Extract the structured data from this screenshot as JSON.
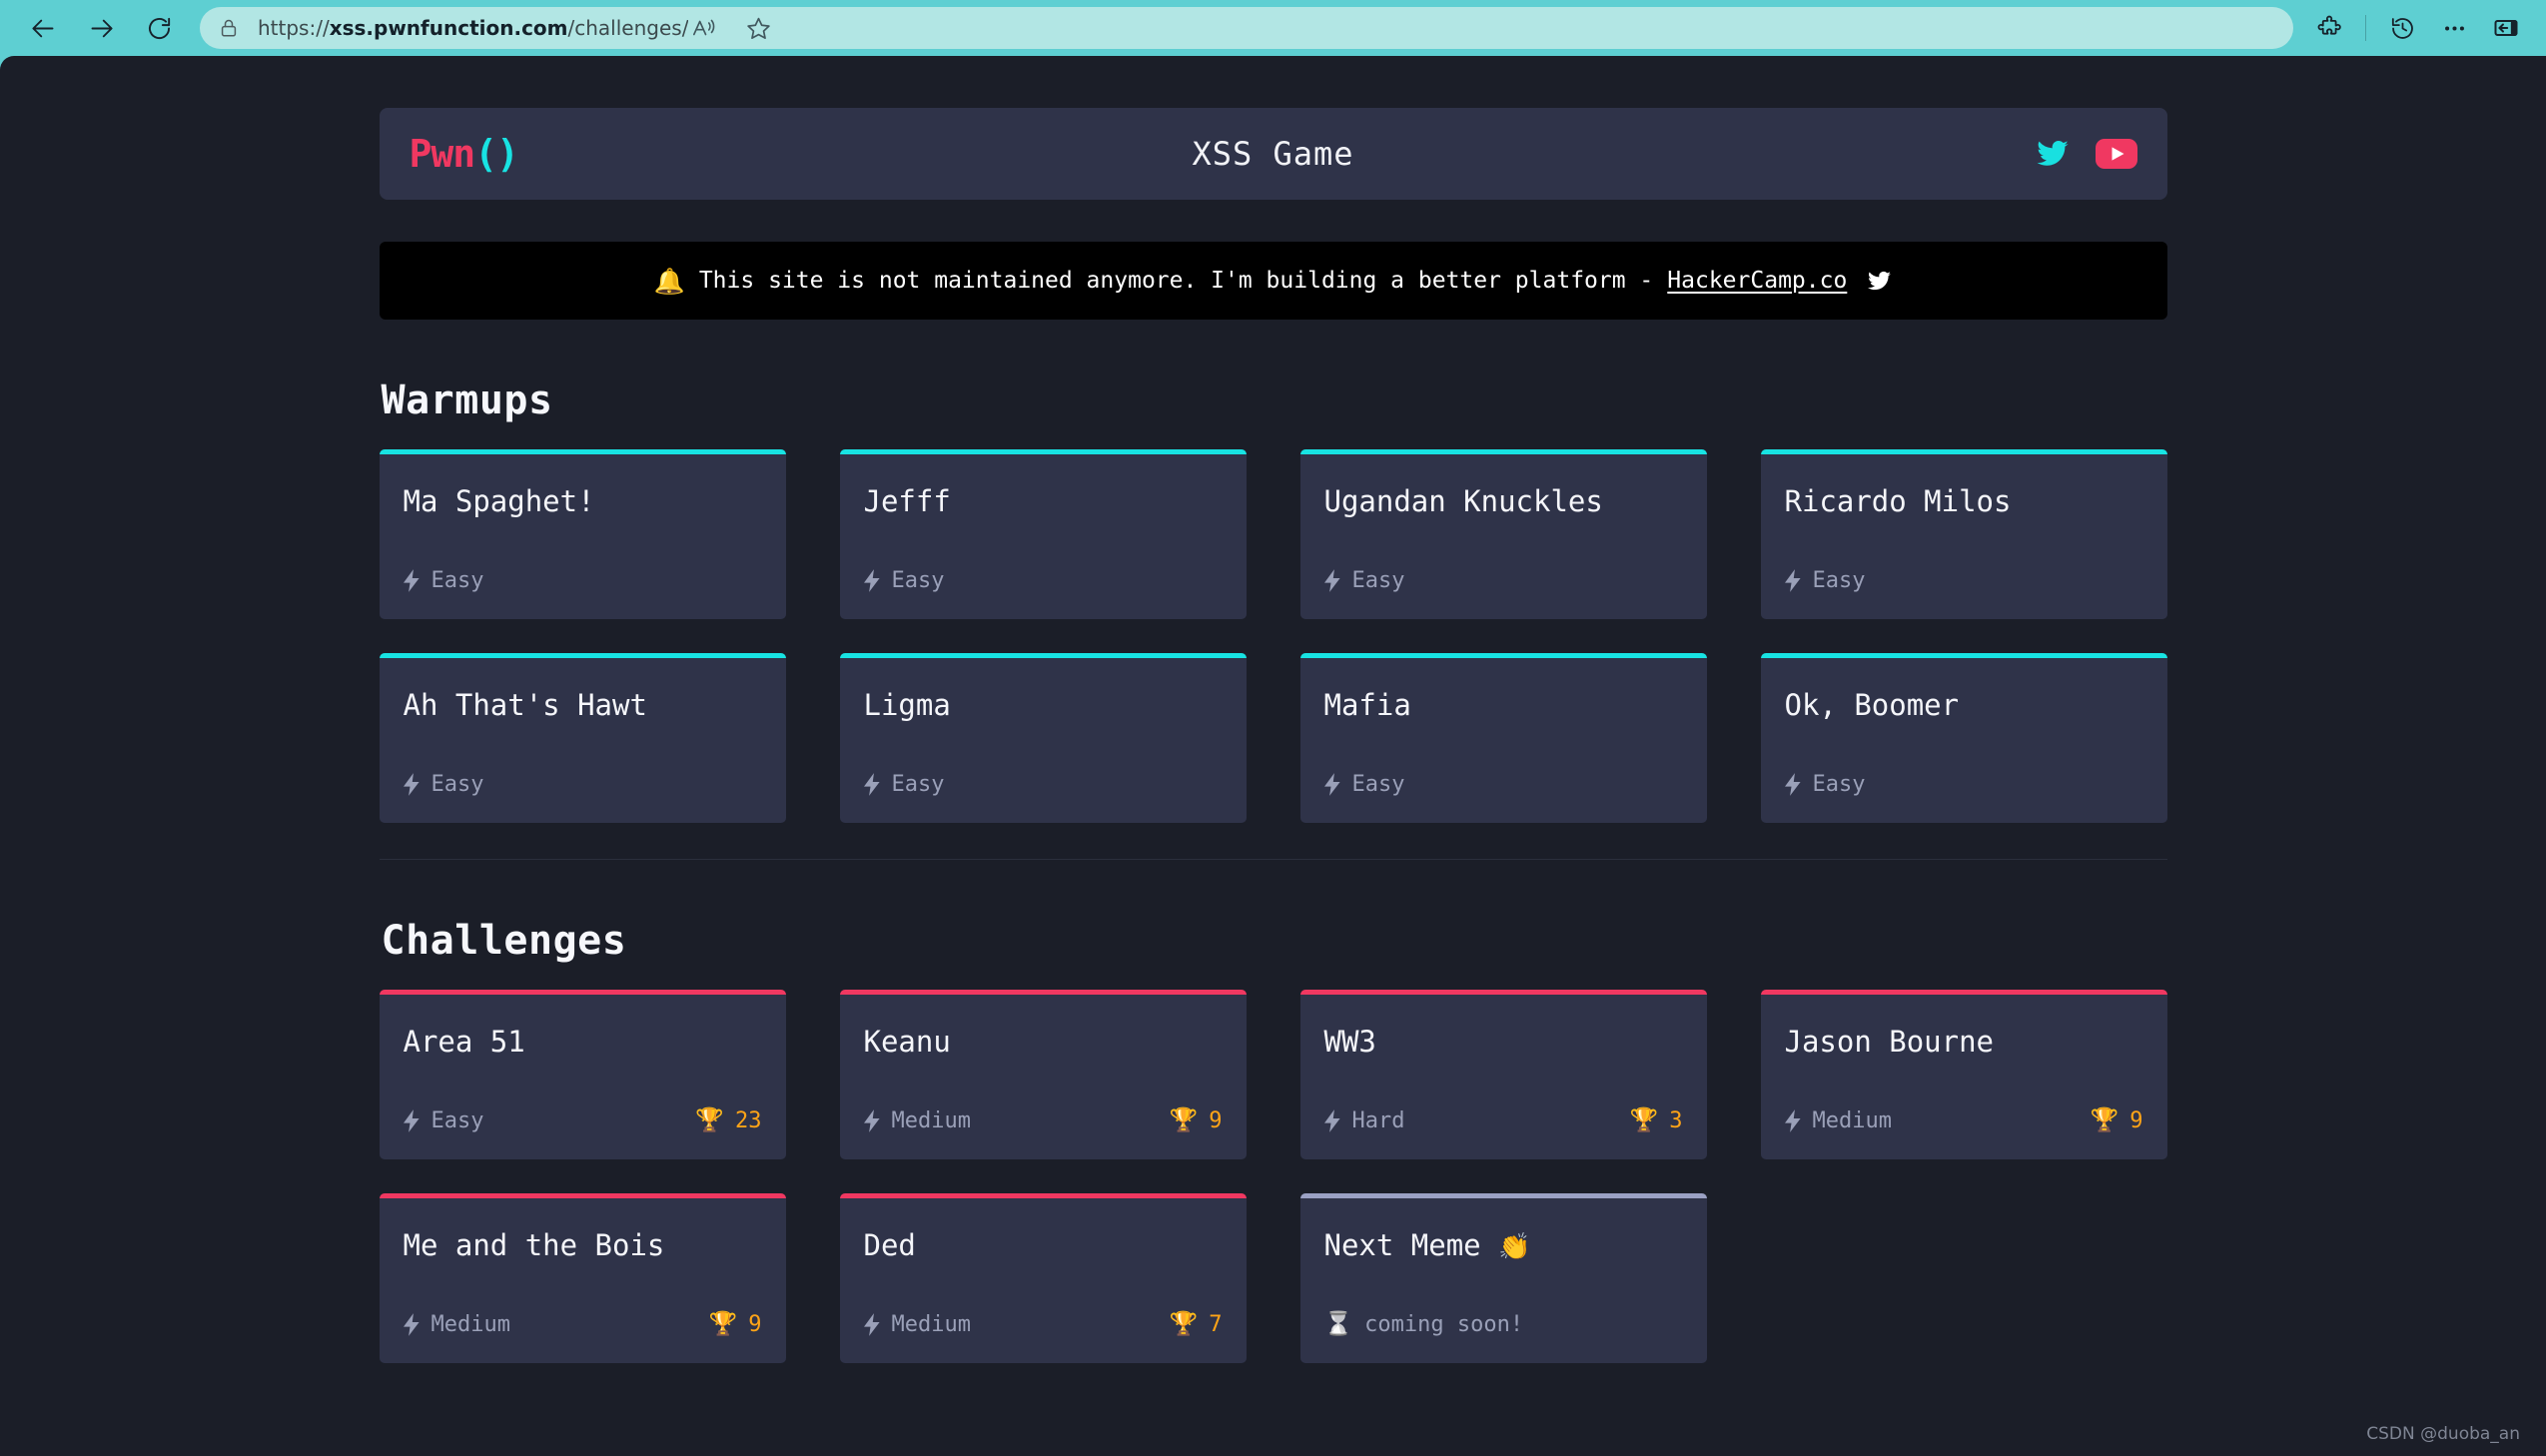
{
  "browser": {
    "back_label": "Back",
    "forward_label": "Forward",
    "reload_label": "Refresh",
    "url_scheme": "https://",
    "url_host": "xss.pwnfunction.com",
    "url_path": "/challenges/",
    "lock_tooltip": "View site information",
    "read_aloud_label": "Read this page aloud",
    "favorite_label": "Add this page to favorites",
    "extensions_label": "Extensions",
    "history_label": "History",
    "settings_label": "Settings and more",
    "sidebar_label": "Browser essentials"
  },
  "header": {
    "brand_name": "Pwn",
    "brand_parens": "()",
    "title": "XSS Game",
    "twitter_label": "Twitter",
    "youtube_label": "YouTube"
  },
  "banner": {
    "icon": "bell-icon",
    "text_before": "This site is not maintained anymore. I'm building a better platform - ",
    "link_text": "HackerCamp.co",
    "twitter_label": "Twitter"
  },
  "sections": [
    {
      "id": "warmups",
      "title": "Warmups",
      "accent": "#18e3e3",
      "cards": [
        {
          "title": "Ma Spaghet!",
          "difficulty": "Easy"
        },
        {
          "title": "Jefff",
          "difficulty": "Easy"
        },
        {
          "title": "Ugandan Knuckles",
          "difficulty": "Easy"
        },
        {
          "title": "Ricardo Milos",
          "difficulty": "Easy"
        },
        {
          "title": "Ah That's Hawt",
          "difficulty": "Easy"
        },
        {
          "title": "Ligma",
          "difficulty": "Easy"
        },
        {
          "title": "Mafia",
          "difficulty": "Easy"
        },
        {
          "title": "Ok, Boomer",
          "difficulty": "Easy"
        }
      ]
    },
    {
      "id": "challenges",
      "title": "Challenges",
      "accent": "#f03861",
      "cards": [
        {
          "title": "Area 51",
          "difficulty": "Easy",
          "score": "23"
        },
        {
          "title": "Keanu",
          "difficulty": "Medium",
          "score": "9"
        },
        {
          "title": "WW3",
          "difficulty": "Hard",
          "score": "3"
        },
        {
          "title": "Jason Bourne",
          "difficulty": "Medium",
          "score": "9"
        },
        {
          "title": "Me and the Bois",
          "difficulty": "Medium",
          "score": "9"
        },
        {
          "title": "Ded",
          "difficulty": "Medium",
          "score": "7"
        },
        {
          "title": "Next Meme",
          "emoji": "👏",
          "status": "coming soon!",
          "coming_soon": true
        }
      ]
    }
  ],
  "icons": {
    "bolt": "⚡",
    "trophy": "🏆",
    "hourglass": "⌛",
    "bell": "🔔"
  },
  "watermark": "CSDN @duoba_an",
  "colors": {
    "chrome": "#5ecfd2",
    "omnibox": "#b2e6e4",
    "page_bg": "#1b1e28",
    "card_bg": "#2f3349",
    "accent_cyan": "#18e3e3",
    "accent_pink": "#f03861",
    "score_orange": "#ffa417",
    "muted_text": "#9aa0b8"
  }
}
